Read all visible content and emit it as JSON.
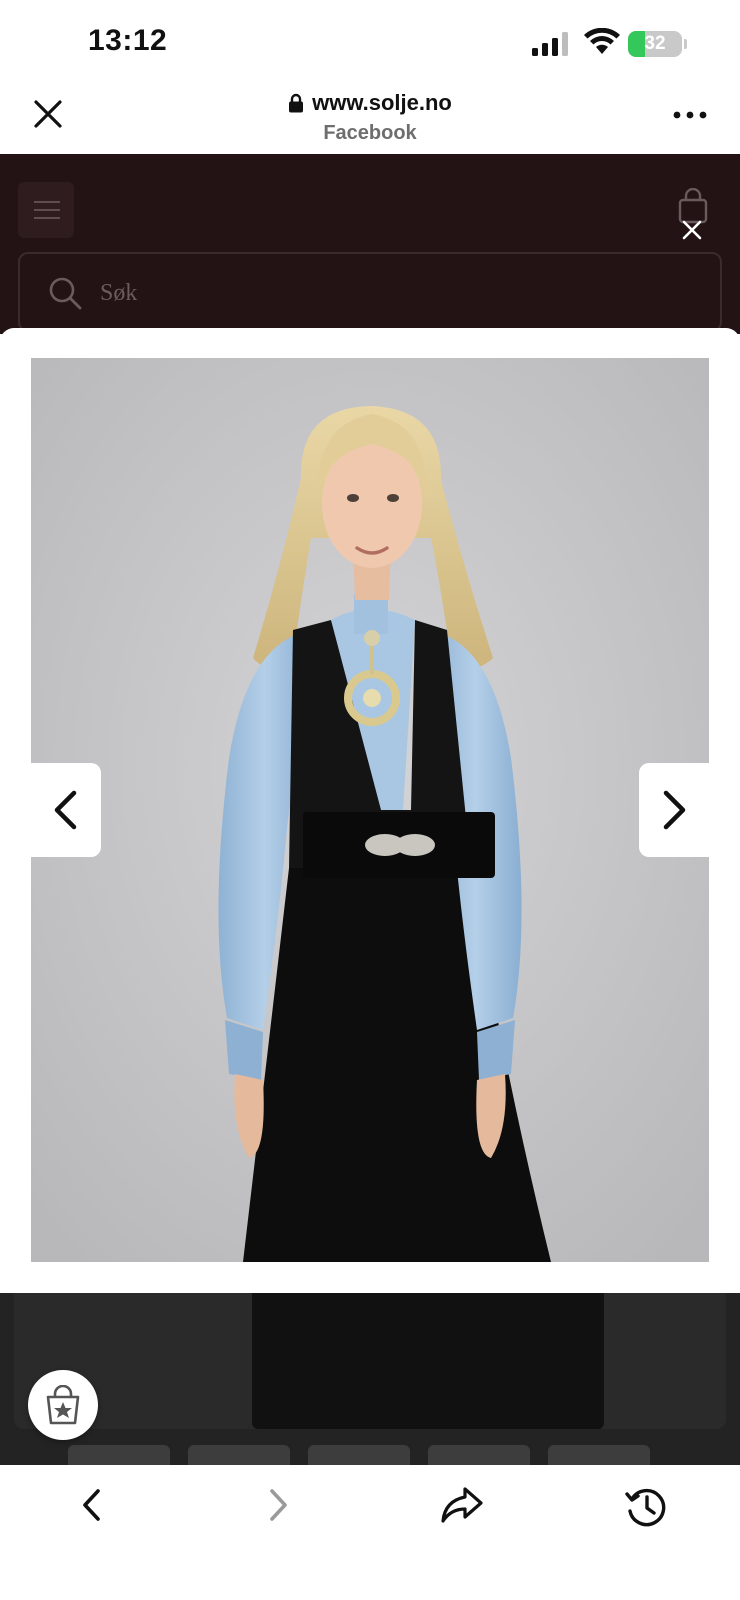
{
  "status_bar": {
    "time": "13:12",
    "battery_level": "32",
    "battery_fill_fraction": 0.32,
    "battery_color": "#34c759"
  },
  "browser": {
    "url": "www.solje.no",
    "source": "Facebook",
    "icons": {
      "close": "close-icon",
      "lock": "lock-icon",
      "more": "more-icon"
    }
  },
  "site": {
    "header_color": "#241315",
    "search_placeholder": "Søk",
    "icons": {
      "menu": "menu-icon",
      "cart": "shopping-bag-icon",
      "search": "search-icon"
    }
  },
  "modal": {
    "image": "product-photo",
    "prev_icon": "chevron-left-icon",
    "next_icon": "chevron-right-icon",
    "close_icon": "close-icon"
  },
  "toolbar": {
    "items": [
      {
        "name": "back",
        "icon": "chevron-left-icon",
        "enabled": true
      },
      {
        "name": "forward",
        "icon": "chevron-right-icon",
        "enabled": false
      },
      {
        "name": "share",
        "icon": "share-icon",
        "enabled": true
      },
      {
        "name": "history",
        "icon": "history-icon",
        "enabled": true
      }
    ]
  },
  "fab": {
    "icon": "shopping-bag-star-icon"
  }
}
